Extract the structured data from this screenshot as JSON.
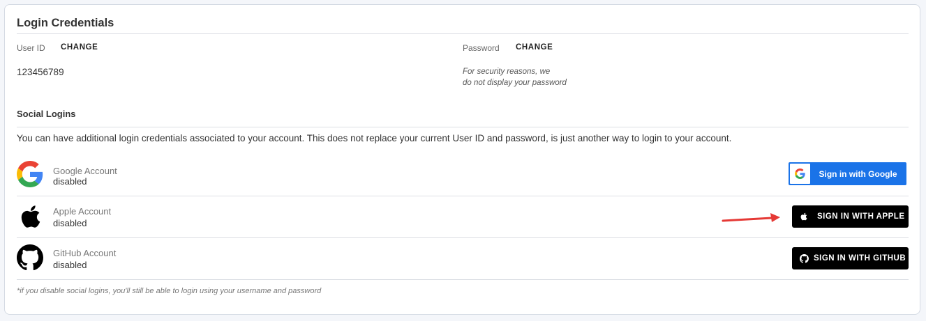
{
  "credentials": {
    "title": "Login Credentials",
    "user_id_label": "User ID",
    "user_id_change": "CHANGE",
    "user_id_value": "123456789",
    "password_label": "Password",
    "password_change": "CHANGE",
    "password_note_line1": "For security reasons, we",
    "password_note_line2": "do not display your password"
  },
  "social": {
    "title": "Social Logins",
    "description": "You can have additional login credentials associated to your account. This does not replace your current User ID and password, is just another way to login to your account.",
    "accounts": [
      {
        "name": "Google Account",
        "status": "disabled",
        "icon": "google-icon",
        "button_label": "Sign in with Google"
      },
      {
        "name": "Apple Account",
        "status": "disabled",
        "icon": "apple-icon",
        "button_label": "SIGN IN WITH APPLE"
      },
      {
        "name": "GitHub Account",
        "status": "disabled",
        "icon": "github-icon",
        "button_label": "SIGN IN WITH GITHUB"
      }
    ],
    "footnote": "*if you disable social logins, you'll still be able to login using your username and password"
  },
  "colors": {
    "google_blue": "#1a73e8",
    "annotation_arrow": "#e53935"
  }
}
